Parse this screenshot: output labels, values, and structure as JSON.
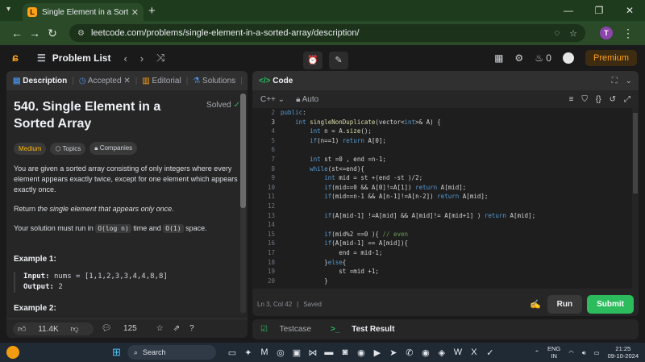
{
  "browser": {
    "tab_title": "Single Element in a Sorted Array",
    "url": "leetcode.com/problems/single-element-in-a-sorted-array/description/",
    "profile_initial": "T"
  },
  "nav": {
    "problem_list": "Problem List",
    "streak": "0",
    "premium": "Premium"
  },
  "left_tabs": {
    "description": "Description",
    "accepted": "Accepted",
    "editorial": "Editorial",
    "solutions": "Solutions",
    "overflow": "S"
  },
  "problem": {
    "title": "540. Single Element in a Sorted Array",
    "status": "Solved",
    "difficulty": "Medium",
    "topics": "Topics",
    "companies": "Companies",
    "para1": "You are given a sorted array consisting of only integers where every element appears exactly twice, except for one element which appears exactly once.",
    "para2_prefix": "Return ",
    "para2_em": "the single element that appears only once",
    "para2_suffix": ".",
    "para3_prefix": "Your solution must run in ",
    "para3_code1": "O(log n)",
    "para3_mid": " time and ",
    "para3_code2": "O(1)",
    "para3_suffix": " space.",
    "example1_title": "Example 1:",
    "example1_input_label": "Input:",
    "example1_input": "nums = [1,1,2,3,3,4,4,8,8]",
    "example1_output_label": "Output:",
    "example1_output": "2",
    "example2_title": "Example 2:"
  },
  "left_footer": {
    "likes": "11.4K",
    "comments": "125"
  },
  "code_panel": {
    "title": "Code",
    "language": "C++",
    "mode": "Auto"
  },
  "code_lines": [
    {
      "n": "2",
      "html": "<span class=\"kw\">public</span>:"
    },
    {
      "n": "3",
      "html": "    <span class=\"kw\">int</span> <span class=\"fn\">singleNonDuplicate</span>(vector&lt;<span class=\"kw\">int</span>&gt;&amp; A) {"
    },
    {
      "n": "4",
      "html": "        <span class=\"kw\">int</span> n = A.<span class=\"fn\">size</span>();"
    },
    {
      "n": "5",
      "html": "        <span class=\"kw\">if</span>(n==1) <span class=\"kw\">return</span> A[0];"
    },
    {
      "n": "6",
      "html": ""
    },
    {
      "n": "7",
      "html": "        <span class=\"kw\">int</span> st =0 , end =n-1;"
    },
    {
      "n": "8",
      "html": "        <span class=\"kw\">while</span>(st&lt;=end){"
    },
    {
      "n": "9",
      "html": "            <span class=\"kw\">int</span> mid = st +(end -st )/2;"
    },
    {
      "n": "10",
      "html": "            <span class=\"kw\">if</span>(mid==0 &amp;&amp; A[0]!=A[1]) <span class=\"kw\">return</span> A[mid];"
    },
    {
      "n": "11",
      "html": "            <span class=\"kw\">if</span>(mid==n-1 &amp;&amp; A[n-1]!=A[n-2]) <span class=\"kw\">return</span> A[mid];"
    },
    {
      "n": "12",
      "html": ""
    },
    {
      "n": "13",
      "html": "            <span class=\"kw\">if</span>(A[mid-1] !=A[mid] &amp;&amp; A[mid]!= A[mid+1] ) <span class=\"kw\">return</span> A[mid];"
    },
    {
      "n": "14",
      "html": ""
    },
    {
      "n": "15",
      "html": "            <span class=\"kw\">if</span>(mid%2 ==0 ){ <span class=\"cm\">// even</span>"
    },
    {
      "n": "16",
      "html": "            <span class=\"kw\">if</span>(A[mid-1] == A[mid]){"
    },
    {
      "n": "17",
      "html": "                end = mid-1;"
    },
    {
      "n": "18",
      "html": "            }<span class=\"kw\">else</span>{"
    },
    {
      "n": "19",
      "html": "                st =mid +1;"
    },
    {
      "n": "20",
      "html": "            }"
    }
  ],
  "editor_status": {
    "position": "Ln 3, Col 42",
    "saved": "Saved",
    "run": "Run",
    "submit": "Submit"
  },
  "bottom_tabs": {
    "testcase": "Testcase",
    "test_result": "Test Result"
  },
  "taskbar": {
    "search": "Search",
    "lang_top": "ENG",
    "lang_bottom": "IN",
    "time": "21:25",
    "date": "09-10-2024"
  }
}
